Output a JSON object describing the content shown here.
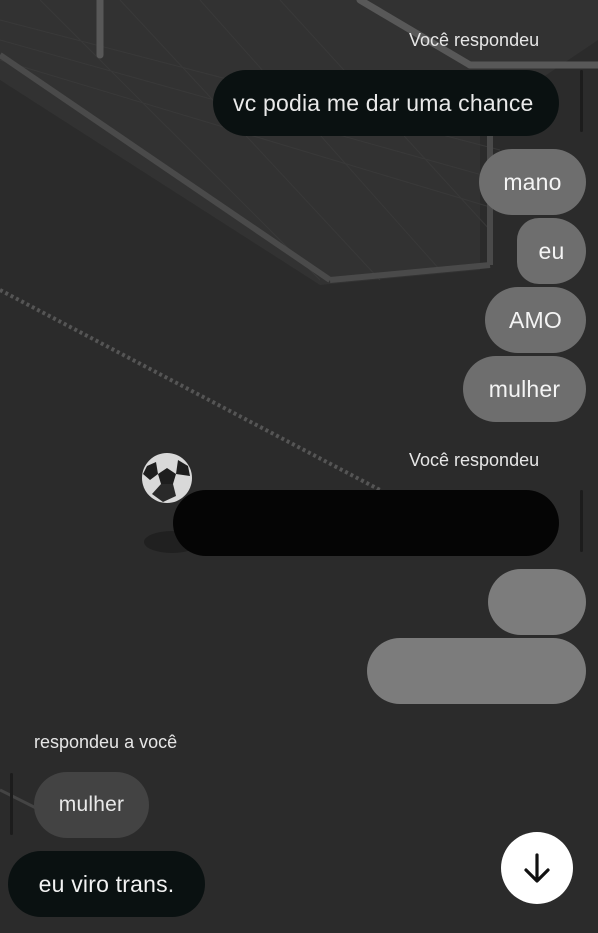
{
  "thread": {
    "reply_label_1": "Você respondeu",
    "reply_quote_1": "vc podia me dar uma chance",
    "messages_1": [
      "mano",
      "eu",
      "AMO",
      "mulher"
    ],
    "reply_label_2": "Você respondeu",
    "reply_label_3": "respondeu a você",
    "incoming_quote": "mulher",
    "incoming_message": "eu viro trans."
  },
  "colors": {
    "background": "#2b2b2b",
    "outgoing_bubble": "#6e6e6e",
    "quoted_bubble": "#0a1111",
    "incoming_quote_bubble": "#434343",
    "scroll_button": "#ffffff"
  },
  "icons": {
    "scroll_down": "arrow-down-icon",
    "background_image": "soccer-ball-goal"
  }
}
